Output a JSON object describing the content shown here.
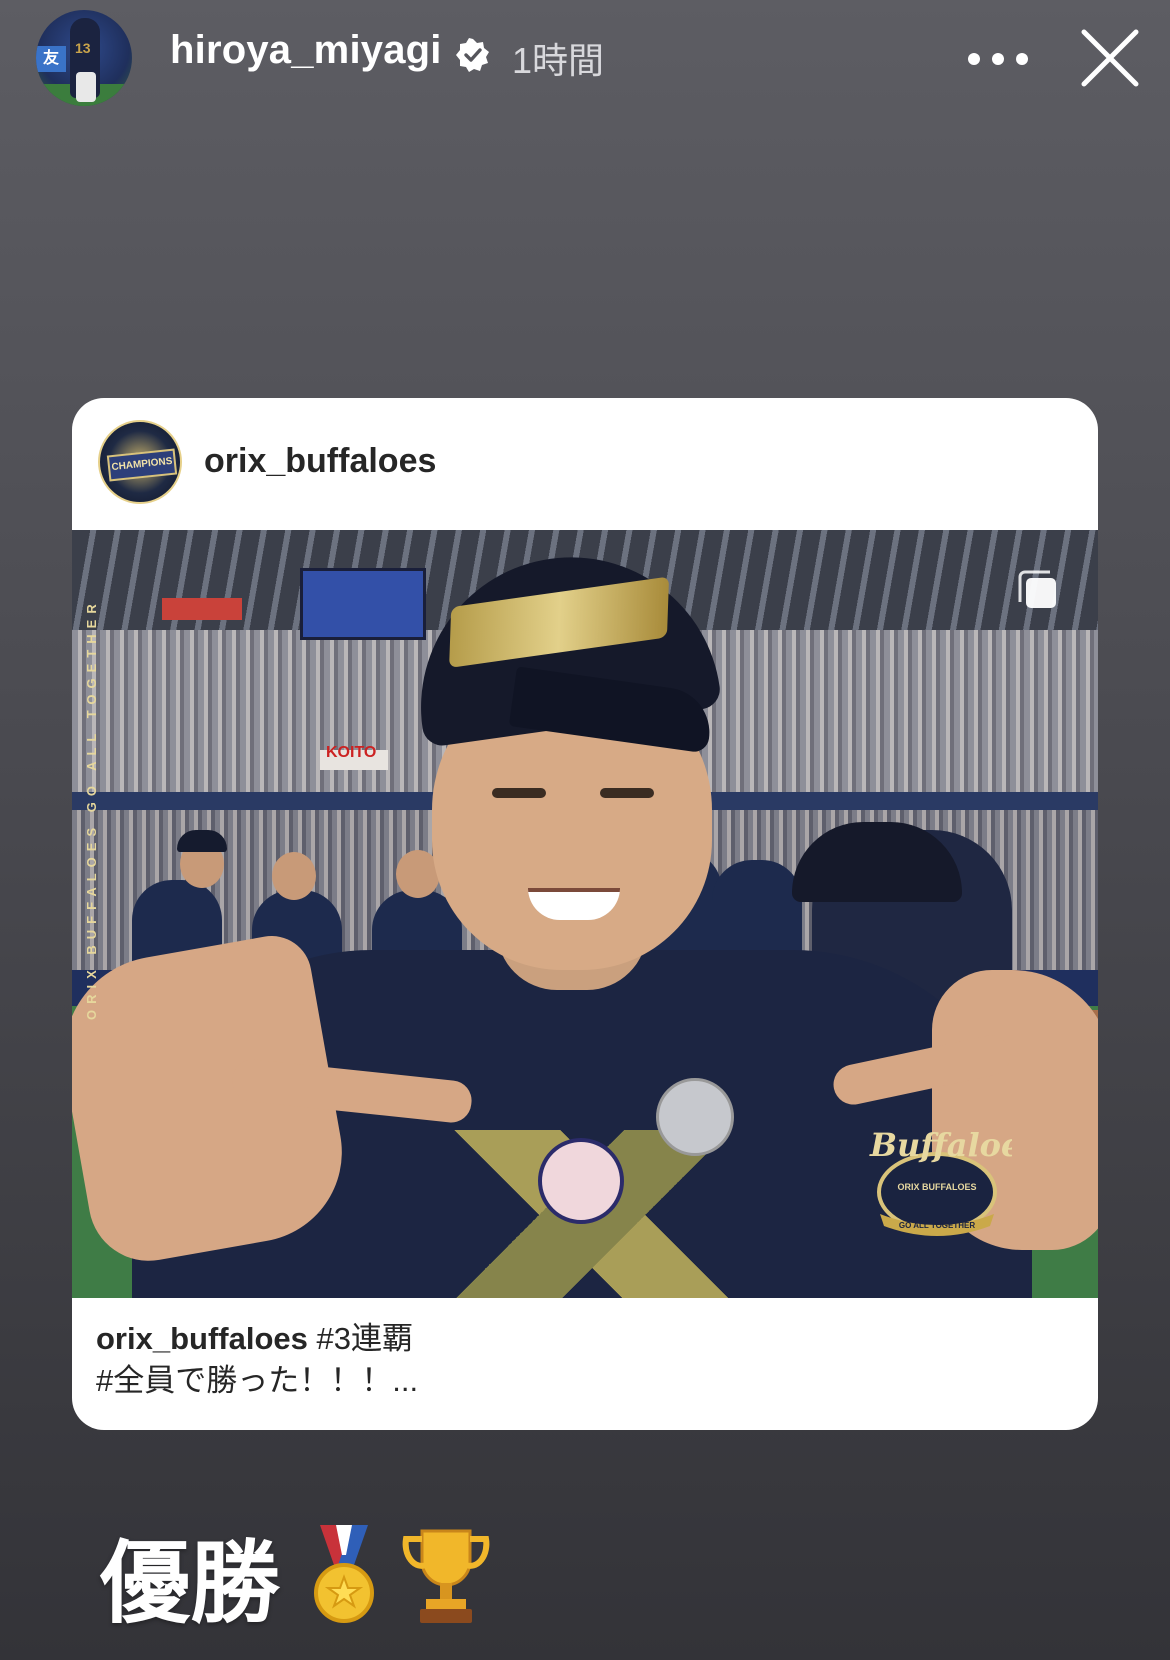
{
  "story": {
    "username": "hiroya_miyagi",
    "time_ago": "1時間",
    "icons": {
      "verified": "verified-badge-icon",
      "more": "more-options-icon",
      "close": "close-icon"
    }
  },
  "shared_post": {
    "username": "orix_buffaloes",
    "caption_user": "orix_buffaloes",
    "caption_line1": " #3連覇",
    "caption_line2": "#全員で勝った！！！...",
    "photo": {
      "vertical_watermark": "ORIX BUFFALOES GO ALL TOGETHER",
      "stadium_ad": "KOITO",
      "logo_text": "Buffaloes",
      "logo_sub": "ORIX BUFFALOES",
      "logo_tagline": "GO ALL TOGETHER"
    },
    "icons": {
      "multiple_photos": "multiple-photos-icon"
    }
  },
  "story_text": {
    "main": "優勝",
    "emojis": [
      "medal-icon",
      "trophy-icon"
    ]
  },
  "colors": {
    "background_top": "#5d5d63",
    "background_bottom": "#333338",
    "card": "#ffffff",
    "team_navy": "#1c2542",
    "team_gold": "#c9b26a"
  }
}
